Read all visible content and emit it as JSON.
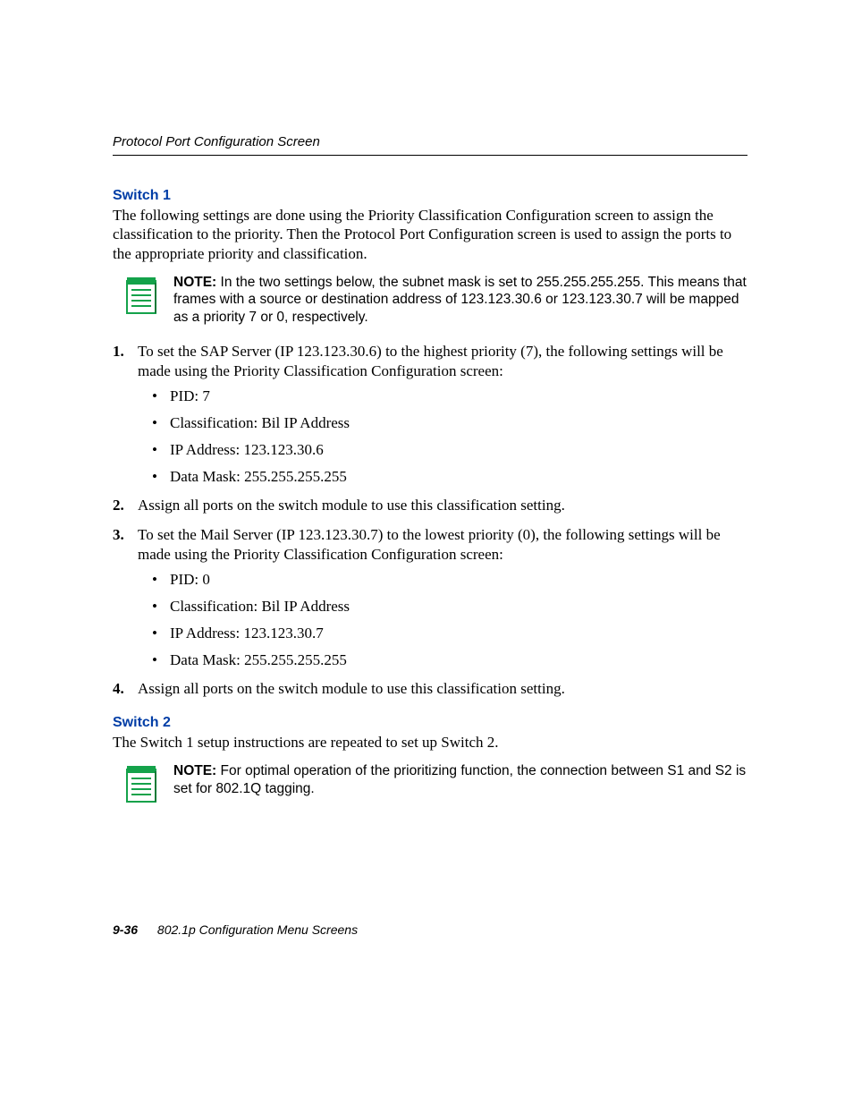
{
  "header": {
    "running_title": "Protocol Port Configuration Screen"
  },
  "switch1": {
    "heading": "Switch 1",
    "intro": "The following settings are done using the Priority Classification Configuration screen to assign the classification to the priority. Then the Protocol Port Configuration screen is used to assign the ports to the appropriate priority and classification.",
    "note": {
      "label": "NOTE:",
      "text": "In the two settings below, the subnet mask is set to 255.255.255.255. This means that frames with a source or destination address of 123.123.30.6 or 123.123.30.7 will be mapped as a priority 7 or 0, respectively."
    },
    "steps": {
      "s1": {
        "marker": "1.",
        "text": "To set the SAP Server (IP 123.123.30.6) to the highest priority (7), the following settings will be made using the Priority Classification Configuration screen:",
        "bullets": [
          "PID: 7",
          "Classification: Bil IP Address",
          "IP Address: 123.123.30.6",
          "Data Mask: 255.255.255.255"
        ]
      },
      "s2": {
        "marker": "2.",
        "text": "Assign all ports on the switch module to use this classification setting."
      },
      "s3": {
        "marker": "3.",
        "text": "To set the Mail Server (IP 123.123.30.7) to the lowest priority (0), the following settings will be made using the Priority Classification Configuration screen:",
        "bullets": [
          "PID: 0",
          "Classification: Bil IP Address",
          "IP Address: 123.123.30.7",
          "Data Mask: 255.255.255.255"
        ]
      },
      "s4": {
        "marker": "4.",
        "text": "Assign all ports on the switch module to use this classification setting."
      }
    }
  },
  "switch2": {
    "heading": "Switch 2",
    "intro": "The Switch 1 setup instructions are repeated to set up Switch 2.",
    "note": {
      "label": "NOTE:",
      "text": "For optimal operation of the prioritizing function, the connection between S1 and S2 is set for 802.1Q tagging."
    }
  },
  "footer": {
    "page_number": "9-36",
    "chapter": "802.1p Configuration Menu Screens"
  }
}
